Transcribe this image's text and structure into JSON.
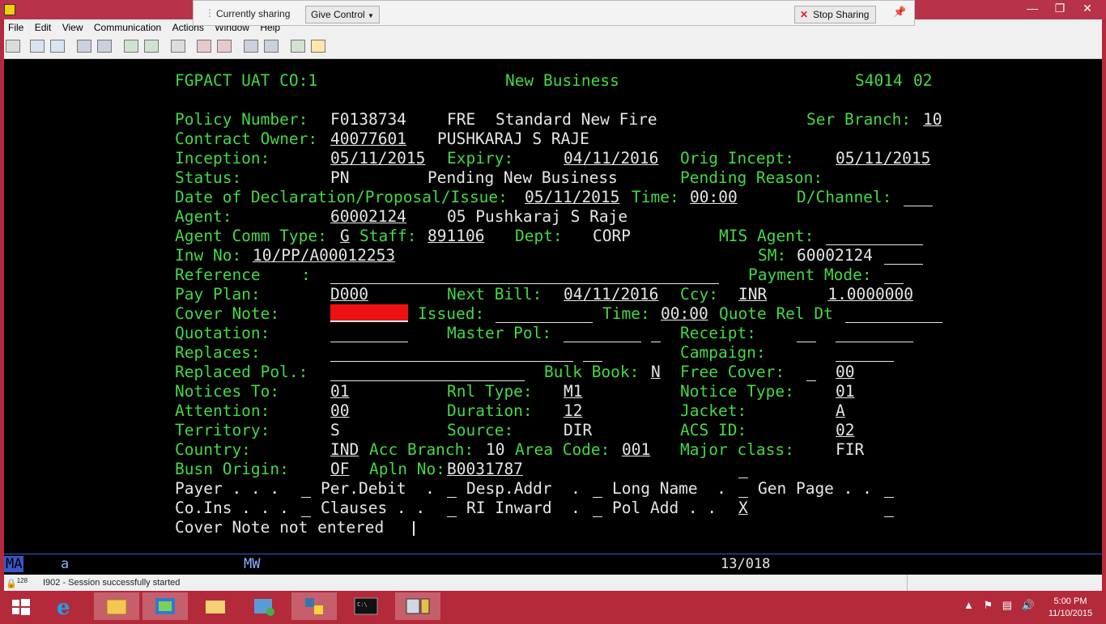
{
  "window": {
    "controls": [
      "—",
      "❐",
      "✕"
    ]
  },
  "menubar": {
    "items": [
      "File",
      "Edit",
      "View",
      "Communication",
      "Actions",
      "Window",
      "Help"
    ]
  },
  "sharebar": {
    "status": "Currently sharing",
    "give_control": "Give Control",
    "stop_sharing": "Stop Sharing"
  },
  "screen": {
    "header": {
      "system": "FGPACT UAT CO:1",
      "title": "New Business",
      "code": "S4014",
      "page": "02"
    },
    "policy_number": {
      "label": "Policy Number:",
      "value": "F0138734",
      "product_code": "FRE",
      "product_desc": "Standard New Fire",
      "ser_branch_label": "Ser Branch:",
      "ser_branch": "10"
    },
    "contract_owner": {
      "label": "Contract Owner:",
      "value": "40077601",
      "name": "PUSHKARAJ S RAJE"
    },
    "inception": {
      "label": "Inception:",
      "value": "05/11/2015",
      "expiry_label": "Expiry:",
      "expiry": "04/11/2016",
      "orig_label": "Orig Incept:",
      "orig": "05/11/2015"
    },
    "status": {
      "label": "Status:",
      "code": "PN",
      "desc": "Pending New Business",
      "pending_label": "Pending Reason:"
    },
    "declaration": {
      "label": "Date of Declaration/Proposal/Issue:",
      "date": "05/11/2015",
      "time_label": "Time:",
      "time": "00:00",
      "channel_label": "D/Channel:"
    },
    "agent": {
      "label": "Agent:",
      "value": "60002124",
      "desc": "05 Pushkaraj S Raje"
    },
    "agent_comm": {
      "label": "Agent Comm Type:",
      "type": "G",
      "staff_label": "Staff:",
      "staff": "891106",
      "dept_label": "Dept:",
      "dept": "CORP",
      "mis_label": "MIS Agent:"
    },
    "inw": {
      "label": "Inw No:",
      "value": "10/PP/A00012253",
      "sm_label": "SM:",
      "sm": "60002124"
    },
    "reference": {
      "label": "Reference",
      "colon": ":",
      "payment_label": "Payment Mode:"
    },
    "pay_plan": {
      "label": "Pay Plan:",
      "value": "D000",
      "next_bill_label": "Next Bill:",
      "next_bill": "04/11/2016",
      "ccy_label": "Ccy:",
      "ccy": "INR",
      "rate": "1.0000000"
    },
    "cover_note": {
      "label": "Cover Note:",
      "issued_label": "Issued:",
      "time_label": "Time:",
      "time": "00:00",
      "quote_label": "Quote Rel Dt"
    },
    "quotation": {
      "label": "Quotation:",
      "master_label": "Master Pol:",
      "receipt_label": "Receipt:"
    },
    "replaces": {
      "label": "Replaces:",
      "campaign_label": "Campaign:"
    },
    "replaced_pol": {
      "label": "Replaced Pol.:",
      "bulk_label": "Bulk Book:",
      "bulk": "N",
      "free_label": "Free Cover:",
      "free": "00"
    },
    "notices_to": {
      "label": "Notices To:",
      "value": "01",
      "rnl_label": "Rnl Type:",
      "rnl": "M1",
      "notice_type_label": "Notice Type:",
      "notice_type": "01"
    },
    "attention": {
      "label": "Attention:",
      "value": "00",
      "duration_label": "Duration:",
      "duration": "12",
      "jacket_label": "Jacket:",
      "jacket": "A"
    },
    "territory": {
      "label": "Territory:",
      "value": "S",
      "source_label": "Source:",
      "source": "DIR",
      "acs_label": "ACS ID:",
      "acs": "02"
    },
    "country": {
      "label": "Country:",
      "value": "IND",
      "acc_label": "Acc Branch:",
      "acc": "10",
      "area_label": "Area Code:",
      "area": "001",
      "major_label": "Major class:",
      "major": "FIR"
    },
    "busn_origin": {
      "label": "Busn Origin:",
      "value": "OF",
      "apln_label": "Apln No:",
      "apln": "B0031787"
    },
    "options_row1": {
      "payer": "Payer . . .",
      "per_debit": "Per.Debit  .",
      "desp_addr": "Desp.Addr  .",
      "long_name": "Long Name  .",
      "gen_page": "Gen Page . ."
    },
    "options_row2": {
      "co_ins": "Co.Ins . . .",
      "clauses": "Clauses . .",
      "ri_inward": "RI Inward  .",
      "pol_add": "Pol Add . .",
      "pol_add_value": "X"
    },
    "message": "Cover Note not entered"
  },
  "oia": {
    "mode": "MA",
    "indicator": "a",
    "mw": "MW",
    "cursor_pos": "13/018"
  },
  "statusbar": {
    "session_id": "128",
    "message": "I902 - Session successfully started"
  },
  "taskbar": {
    "clock_time": "5:00 PM",
    "clock_date": "11/10/2015"
  }
}
